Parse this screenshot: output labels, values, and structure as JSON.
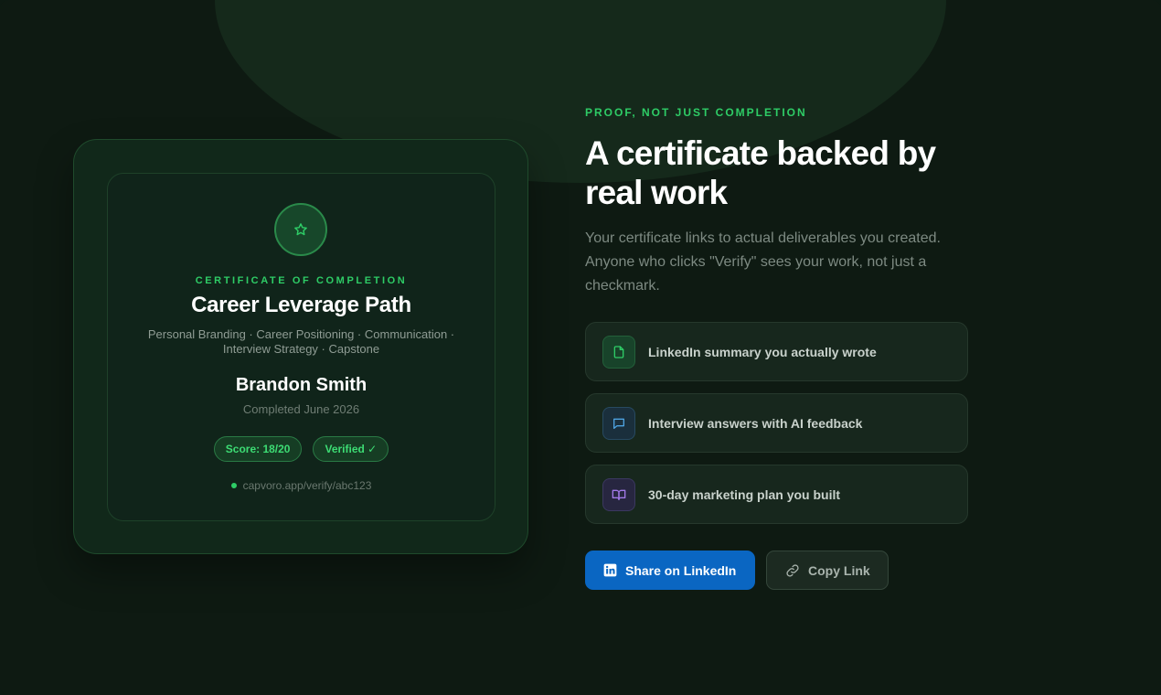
{
  "colors": {
    "accent_green": "#2ecc66",
    "linkedin_blue": "#0a66c2",
    "background": "#0e1a12"
  },
  "certificate": {
    "badge_icon": "star-icon",
    "kicker": "CERTIFICATE OF COMPLETION",
    "title": "Career Leverage Path",
    "modules_line1": "Personal Branding · Career Positioning · Communication ·",
    "modules_line2": "Interview Strategy · Capstone",
    "recipient": "Brandon Smith",
    "completed": "Completed June 2026",
    "score_label": "Score: 18/20",
    "verified_label": "Verified ✓",
    "verify_url": "capvoro.app/verify/abc123"
  },
  "hero": {
    "kicker": "PROOF, NOT JUST COMPLETION",
    "headline_line1": "A certificate backed by",
    "headline_line2": "real work",
    "subtext": "Your certificate links to actual deliverables you created. Anyone who clicks \"Verify\" sees your work, not just a checkmark."
  },
  "deliverables": [
    {
      "icon": "document-icon",
      "label": "LinkedIn summary you actually wrote"
    },
    {
      "icon": "chat-bubble-icon",
      "label": "Interview answers with AI feedback"
    },
    {
      "icon": "open-book-icon",
      "label": "30-day marketing plan you built"
    }
  ],
  "actions": {
    "share_label": "Share on LinkedIn",
    "share_icon": "linkedin-icon",
    "copy_label": "Copy Link",
    "copy_icon": "link-icon"
  }
}
